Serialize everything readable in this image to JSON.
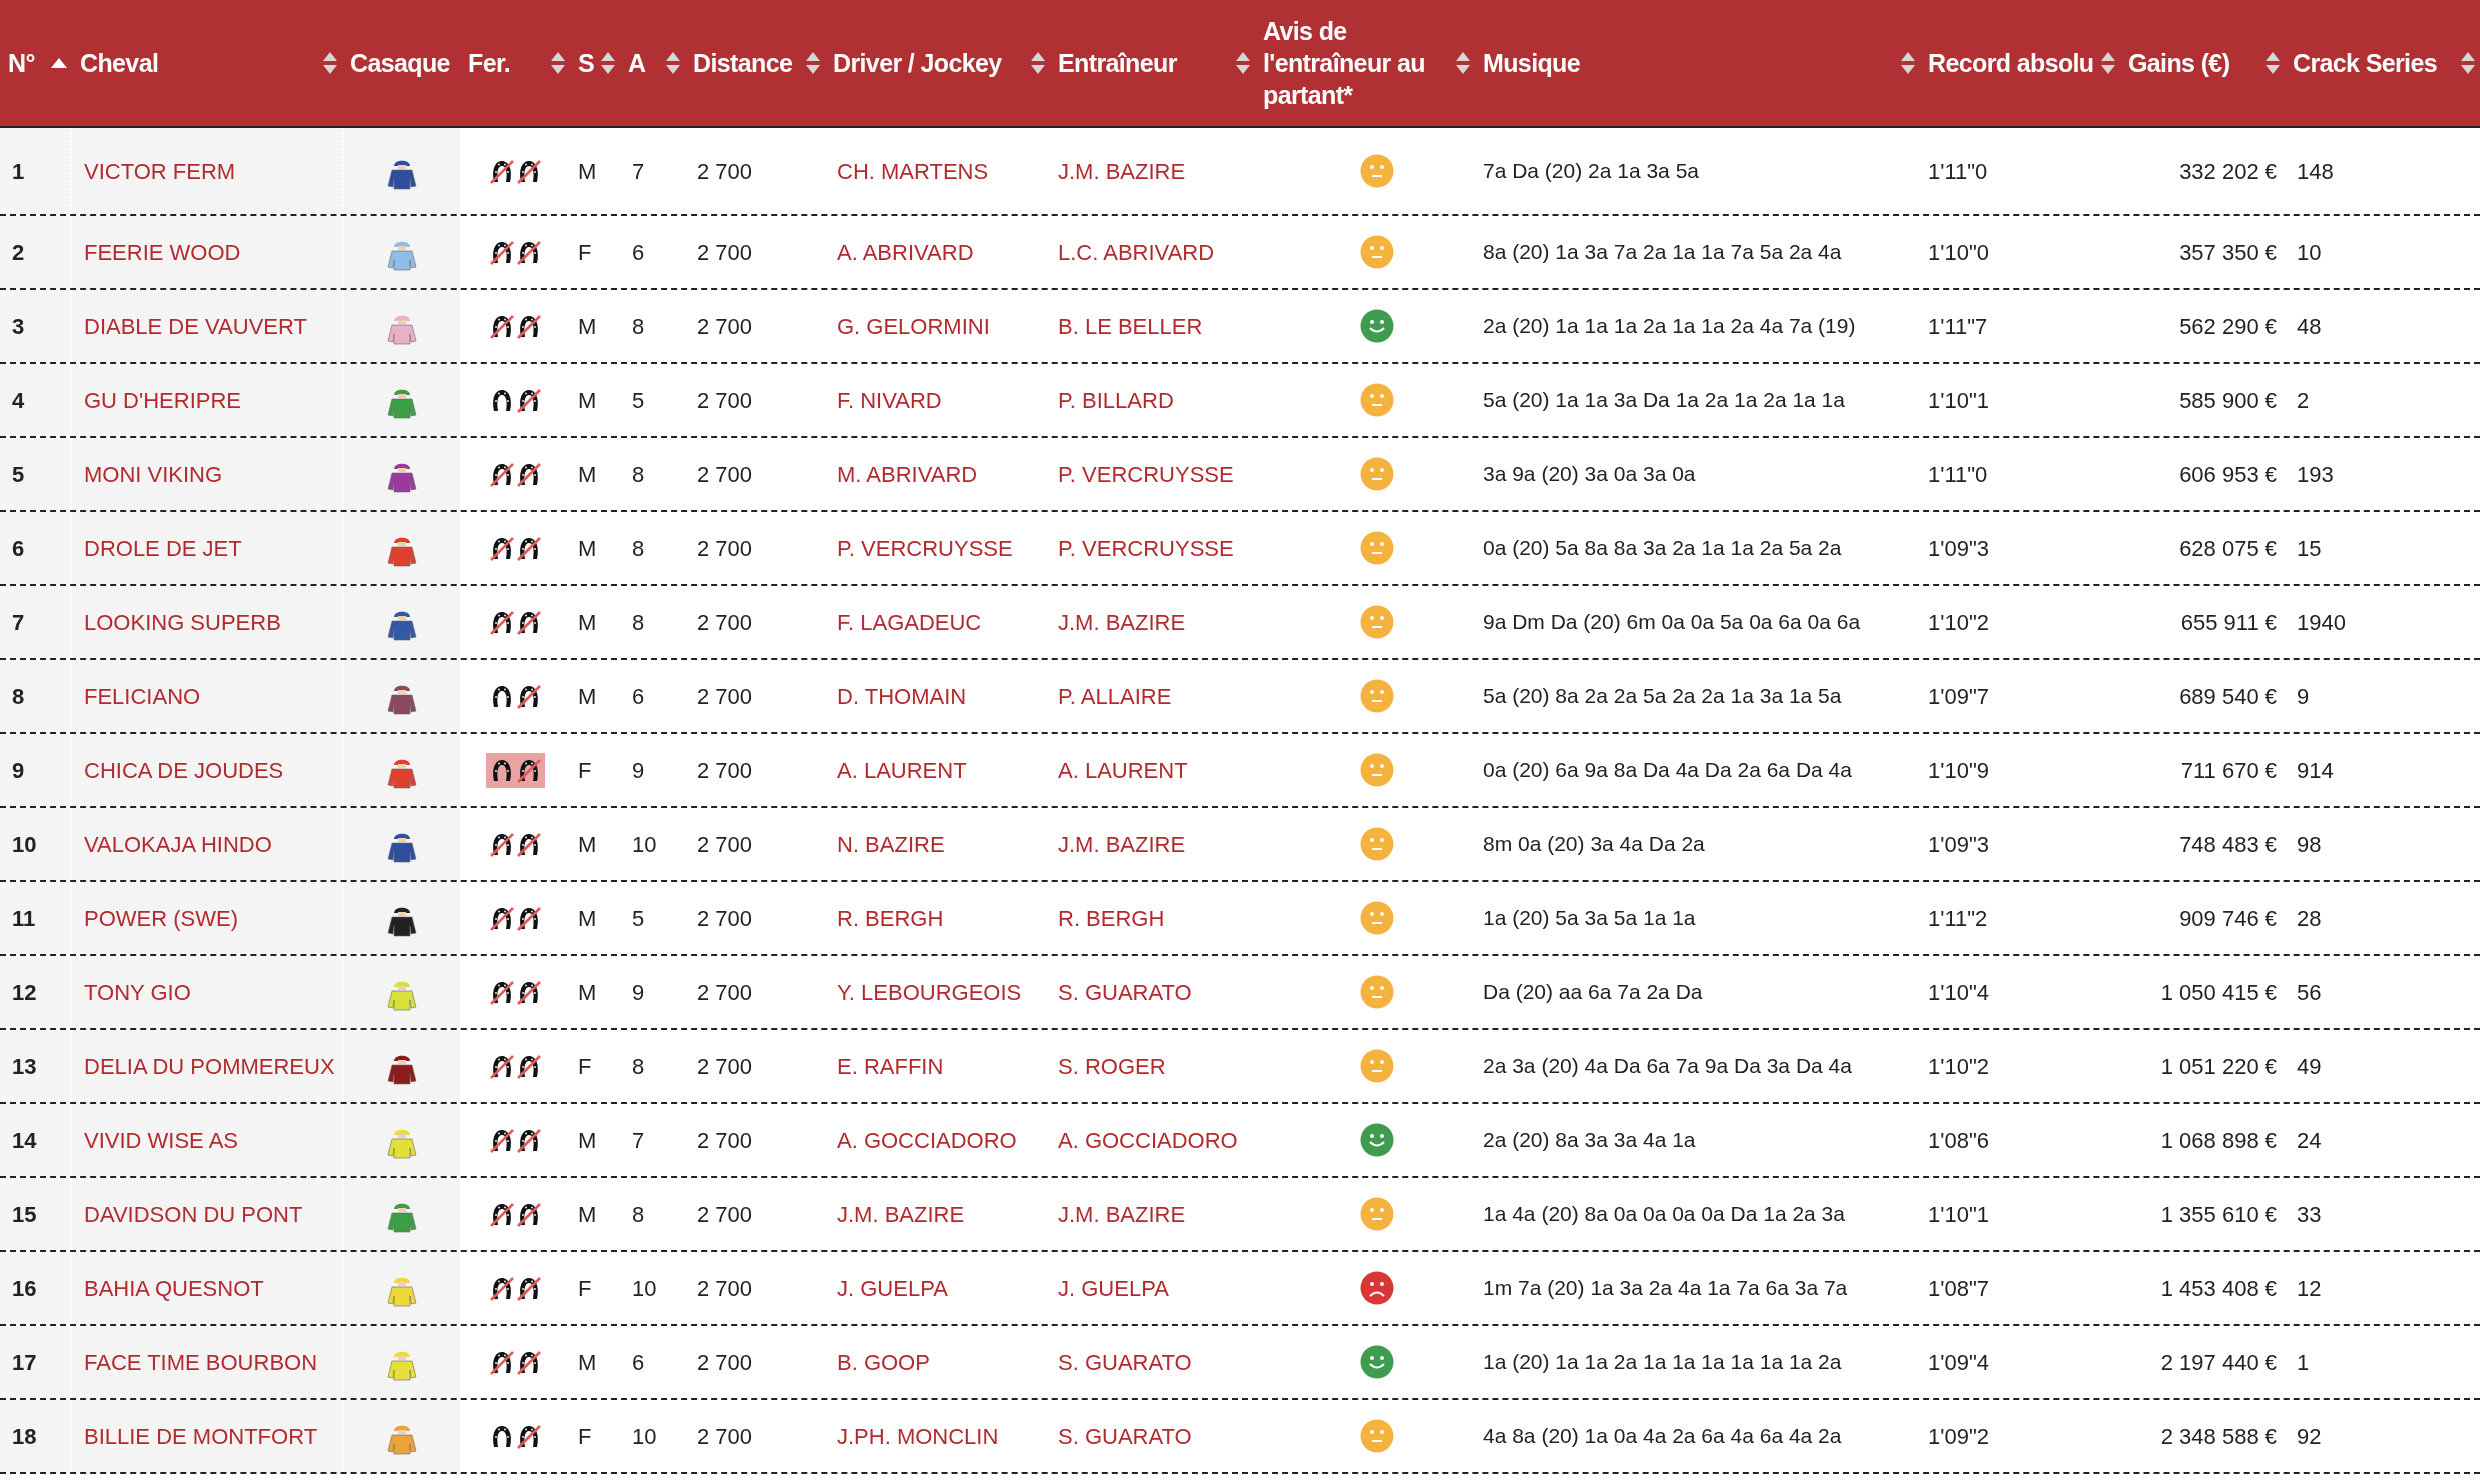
{
  "columns": [
    {
      "label": "N°",
      "sortable": true,
      "sorted": true
    },
    {
      "label": "Cheval",
      "sortable": true,
      "sorted": false
    },
    {
      "label": "Casaque",
      "sortable": false,
      "sorted": false
    },
    {
      "label": "Fer.",
      "sortable": true,
      "sorted": false
    },
    {
      "label": "S",
      "sortable": true,
      "sorted": false
    },
    {
      "label": "A",
      "sortable": true,
      "sorted": false
    },
    {
      "label": "Distance",
      "sortable": true,
      "sorted": false
    },
    {
      "label": "Driver / Jockey",
      "sortable": true,
      "sorted": false
    },
    {
      "label": "Entraîneur",
      "sortable": true,
      "sorted": false
    },
    {
      "label": "Avis de l'entraîneur au partant*",
      "sortable": true,
      "sorted": false
    },
    {
      "label": "Musique",
      "sortable": true,
      "sorted": false
    },
    {
      "label": "Record absolu",
      "sortable": true,
      "sorted": false
    },
    {
      "label": "Gains (€)",
      "sortable": true,
      "sorted": false
    },
    {
      "label": "Crack Series",
      "sortable": true,
      "sorted": false
    }
  ],
  "rows": [
    {
      "number": "1",
      "horse": "VICTOR FERM",
      "color": "#2f4f9e",
      "front_unshod": true,
      "hind_unshod": true,
      "highlighted": false,
      "sex": "M",
      "age": "7",
      "distance": "2 700",
      "driver": "CH. MARTENS",
      "trainer": "J.M. BAZIRE",
      "opinion": {
        "kind": "neutral"
      },
      "music": "7a Da (20) 2a 1a 3a 5a",
      "record": "1'11\"0",
      "gains": "332 202 €",
      "crack": "148"
    },
    {
      "number": "2",
      "horse": "FEERIE WOOD",
      "color": "#8fbde6",
      "front_unshod": true,
      "hind_unshod": true,
      "highlighted": false,
      "sex": "F",
      "age": "6",
      "distance": "2 700",
      "driver": "A. ABRIVARD",
      "trainer": "L.C. ABRIVARD",
      "opinion": {
        "kind": "neutral"
      },
      "music": "8a (20) 1a 3a 7a 2a 1a 1a 7a 5a 2a 4a",
      "record": "1'10\"0",
      "gains": "357 350 €",
      "crack": "10"
    },
    {
      "number": "3",
      "horse": "DIABLE DE VAUVERT",
      "color": "#eab0c8",
      "front_unshod": true,
      "hind_unshod": true,
      "highlighted": false,
      "sex": "M",
      "age": "8",
      "distance": "2 700",
      "driver": "G. GELORMINI",
      "trainer": "B. LE BELLER",
      "opinion": {
        "kind": "happy"
      },
      "music": "2a (20) 1a 1a 1a 2a 1a 1a 2a 4a 7a (19)",
      "record": "1'11\"7",
      "gains": "562 290 €",
      "crack": "48"
    },
    {
      "number": "4",
      "horse": "GU D'HERIPRE",
      "color": "#3aa043",
      "front_unshod": false,
      "hind_unshod": true,
      "highlighted": false,
      "sex": "M",
      "age": "5",
      "distance": "2 700",
      "driver": "F. NIVARD",
      "trainer": "P. BILLARD",
      "opinion": {
        "kind": "neutral"
      },
      "music": "5a (20) 1a 1a 3a Da 1a 2a 1a 2a 1a 1a",
      "record": "1'10\"1",
      "gains": "585 900 €",
      "crack": "2"
    },
    {
      "number": "5",
      "horse": "MONI VIKING",
      "color": "#9b3a9e",
      "front_unshod": true,
      "hind_unshod": true,
      "highlighted": false,
      "sex": "M",
      "age": "8",
      "distance": "2 700",
      "driver": "M. ABRIVARD",
      "trainer": "P. VERCRUYSSE",
      "opinion": {
        "kind": "neutral"
      },
      "music": "3a 9a (20) 3a 0a 3a 0a",
      "record": "1'11\"0",
      "gains": "606 953 €",
      "crack": "193"
    },
    {
      "number": "6",
      "horse": "DROLE DE JET",
      "color": "#e0402c",
      "front_unshod": true,
      "hind_unshod": true,
      "highlighted": false,
      "sex": "M",
      "age": "8",
      "distance": "2 700",
      "driver": "P. VERCRUYSSE",
      "trainer": "P. VERCRUYSSE",
      "opinion": {
        "kind": "neutral"
      },
      "music": "0a (20) 5a 8a 8a 3a 2a 1a 1a 2a 5a 2a",
      "record": "1'09\"3",
      "gains": "628 075 €",
      "crack": "15"
    },
    {
      "number": "7",
      "horse": "LOOKING SUPERB",
      "color": "#3358a8",
      "front_unshod": true,
      "hind_unshod": true,
      "highlighted": false,
      "sex": "M",
      "age": "8",
      "distance": "2 700",
      "driver": "F. LAGADEUC",
      "trainer": "J.M. BAZIRE",
      "opinion": {
        "kind": "neutral"
      },
      "music": "9a Dm Da (20) 6m 0a 0a 5a 0a 6a 0a 6a",
      "record": "1'10\"2",
      "gains": "655 911 €",
      "crack": "1940"
    },
    {
      "number": "8",
      "horse": "FELICIANO",
      "color": "#8a4a5e",
      "front_unshod": false,
      "hind_unshod": true,
      "highlighted": false,
      "sex": "M",
      "age": "6",
      "distance": "2 700",
      "driver": "D. THOMAIN",
      "trainer": "P. ALLAIRE",
      "opinion": {
        "kind": "neutral"
      },
      "music": "5a (20) 8a 2a 2a 5a 2a 2a 1a 3a 1a 5a",
      "record": "1'09\"7",
      "gains": "689 540 €",
      "crack": "9"
    },
    {
      "number": "9",
      "horse": "CHICA DE JOUDES",
      "color": "#e0402c",
      "front_unshod": false,
      "hind_unshod": true,
      "highlighted": true,
      "sex": "F",
      "age": "9",
      "distance": "2 700",
      "driver": "A. LAURENT",
      "trainer": "A. LAURENT",
      "opinion": {
        "kind": "neutral"
      },
      "music": "0a (20) 6a 9a 8a Da 4a Da 2a 6a Da 4a",
      "record": "1'10\"9",
      "gains": "711 670 €",
      "crack": "914"
    },
    {
      "number": "10",
      "horse": "VALOKAJA HINDO",
      "color": "#2f4f9e",
      "front_unshod": true,
      "hind_unshod": true,
      "highlighted": false,
      "sex": "M",
      "age": "10",
      "distance": "2 700",
      "driver": "N. BAZIRE",
      "trainer": "J.M. BAZIRE",
      "opinion": {
        "kind": "neutral"
      },
      "music": "8m 0a (20) 3a 4a Da 2a",
      "record": "1'09\"3",
      "gains": "748 483 €",
      "crack": "98"
    },
    {
      "number": "11",
      "horse": "POWER (SWE)",
      "color": "#222222",
      "front_unshod": true,
      "hind_unshod": true,
      "highlighted": false,
      "sex": "M",
      "age": "5",
      "distance": "2 700",
      "driver": "R. BERGH",
      "trainer": "R. BERGH",
      "opinion": {
        "kind": "neutral"
      },
      "music": "1a (20) 5a 3a 5a 1a 1a",
      "record": "1'11\"2",
      "gains": "909 746 €",
      "crack": "28"
    },
    {
      "number": "12",
      "horse": "TONY GIO",
      "color": "#d8e03a",
      "front_unshod": true,
      "hind_unshod": true,
      "highlighted": false,
      "sex": "M",
      "age": "9",
      "distance": "2 700",
      "driver": "Y. LEBOURGEOIS",
      "trainer": "S. GUARATO",
      "opinion": {
        "kind": "neutral"
      },
      "music": "Da (20) aa 6a 7a 2a Da",
      "record": "1'10\"4",
      "gains": "1 050 415 €",
      "crack": "56"
    },
    {
      "number": "13",
      "horse": "DELIA DU POMMEREUX",
      "color": "#8a1c1c",
      "front_unshod": true,
      "hind_unshod": true,
      "highlighted": false,
      "sex": "F",
      "age": "8",
      "distance": "2 700",
      "driver": "E. RAFFIN",
      "trainer": "S. ROGER",
      "opinion": {
        "kind": "neutral"
      },
      "music": "2a 3a (20) 4a Da 6a 7a 9a Da 3a Da 4a",
      "record": "1'10\"2",
      "gains": "1 051 220 €",
      "crack": "49"
    },
    {
      "number": "14",
      "horse": "VIVID WISE AS",
      "color": "#e3df3a",
      "front_unshod": true,
      "hind_unshod": true,
      "highlighted": false,
      "sex": "M",
      "age": "7",
      "distance": "2 700",
      "driver": "A. GOCCIADORO",
      "trainer": "A. GOCCIADORO",
      "opinion": {
        "kind": "happy"
      },
      "music": "2a (20) 8a 3a 3a 4a 1a",
      "record": "1'08\"6",
      "gains": "1 068 898 €",
      "crack": "24"
    },
    {
      "number": "15",
      "horse": "DAVIDSON DU PONT",
      "color": "#3aa043",
      "front_unshod": true,
      "hind_unshod": true,
      "highlighted": false,
      "sex": "M",
      "age": "8",
      "distance": "2 700",
      "driver": "J.M. BAZIRE",
      "trainer": "J.M. BAZIRE",
      "opinion": {
        "kind": "neutral"
      },
      "music": "1a 4a (20) 8a 0a 0a 0a 0a Da 1a 2a 3a",
      "record": "1'10\"1",
      "gains": "1 355 610 €",
      "crack": "33"
    },
    {
      "number": "16",
      "horse": "BAHIA QUESNOT",
      "color": "#f0d83a",
      "front_unshod": true,
      "hind_unshod": true,
      "highlighted": false,
      "sex": "F",
      "age": "10",
      "distance": "2 700",
      "driver": "J. GUELPA",
      "trainer": "J. GUELPA",
      "opinion": {
        "kind": "sad"
      },
      "music": "1m 7a (20) 1a 3a 2a 4a 1a 7a 6a 3a 7a",
      "record": "1'08\"7",
      "gains": "1 453 408 €",
      "crack": "12"
    },
    {
      "number": "17",
      "horse": "FACE TIME BOURBON",
      "color": "#e8e03a",
      "front_unshod": true,
      "hind_unshod": true,
      "highlighted": false,
      "sex": "M",
      "age": "6",
      "distance": "2 700",
      "driver": "B. GOOP",
      "trainer": "S. GUARATO",
      "opinion": {
        "kind": "happy"
      },
      "music": "1a (20) 1a 1a 2a 1a 1a 1a 1a 1a 1a 2a",
      "record": "1'09\"4",
      "gains": "2 197 440 €",
      "crack": "1"
    },
    {
      "number": "18",
      "horse": "BILLIE DE MONTFORT",
      "color": "#eba33a",
      "front_unshod": false,
      "hind_unshod": true,
      "highlighted": false,
      "sex": "F",
      "age": "10",
      "distance": "2 700",
      "driver": "J.PH. MONCLIN",
      "trainer": "S. GUARATO",
      "opinion": {
        "kind": "neutral"
      },
      "music": "4a 8a (20) 1a 0a 4a 2a 6a 4a 6a 4a 2a",
      "record": "1'09\"2",
      "gains": "2 348 588 €",
      "crack": "92"
    }
  ]
}
